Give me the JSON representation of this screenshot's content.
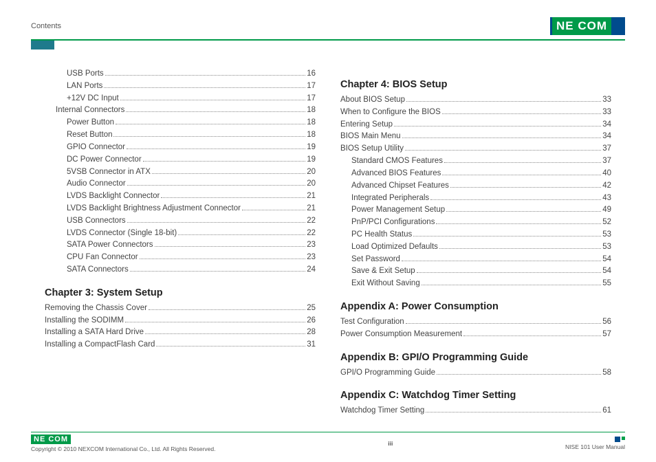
{
  "header": {
    "section_label": "Contents",
    "logo_text": "NE COM"
  },
  "left": {
    "opening_entries": [
      {
        "label": "USB Ports",
        "page": "16",
        "indent": 2
      },
      {
        "label": "LAN Ports",
        "page": "17",
        "indent": 2
      },
      {
        "label": "+12V DC Input",
        "page": "17",
        "indent": 2
      },
      {
        "label": "Internal Connectors",
        "page": "18",
        "indent": 1
      },
      {
        "label": "Power Button",
        "page": "18",
        "indent": 2
      },
      {
        "label": "Reset Button",
        "page": "18",
        "indent": 2
      },
      {
        "label": "GPIO Connector",
        "page": "19",
        "indent": 2
      },
      {
        "label": "DC Power Connector",
        "page": "19",
        "indent": 2
      },
      {
        "label": "5VSB Connector in ATX",
        "page": "20",
        "indent": 2
      },
      {
        "label": "Audio Connector",
        "page": "20",
        "indent": 2
      },
      {
        "label": "LVDS Backlight Connector",
        "page": "21",
        "indent": 2
      },
      {
        "label": "LVDS Backlight Brightness Adjustment Connector",
        "page": "21",
        "indent": 2
      },
      {
        "label": "USB Connectors",
        "page": "22",
        "indent": 2
      },
      {
        "label": "LVDS Connector (Single 18-bit)",
        "page": "22",
        "indent": 2
      },
      {
        "label": "SATA Power Connectors",
        "page": "23",
        "indent": 2
      },
      {
        "label": "CPU Fan Connector",
        "page": "23",
        "indent": 2
      },
      {
        "label": "SATA Connectors",
        "page": "24",
        "indent": 2
      }
    ],
    "chapter3": {
      "title": "Chapter 3: System Setup",
      "entries": [
        {
          "label": "Removing the Chassis Cover",
          "page": "25",
          "indent": 0
        },
        {
          "label": "Installing the SODIMM",
          "page": "26",
          "indent": 0
        },
        {
          "label": "Installing a SATA Hard Drive",
          "page": "28",
          "indent": 0
        },
        {
          "label": "Installing a CompactFlash Card",
          "page": "31",
          "indent": 0
        }
      ]
    }
  },
  "right": {
    "chapter4": {
      "title": "Chapter 4: BIOS Setup",
      "entries": [
        {
          "label": "About BIOS Setup",
          "page": "33",
          "indent": 0
        },
        {
          "label": "When to Configure the BIOS",
          "page": "33",
          "indent": 0
        },
        {
          "label": "Entering Setup",
          "page": "34",
          "indent": 0
        },
        {
          "label": "BIOS Main Menu",
          "page": "34",
          "indent": 0
        },
        {
          "label": "BIOS Setup Utility",
          "page": "37",
          "indent": 0
        },
        {
          "label": "Standard CMOS Features",
          "page": "37",
          "indent": 1
        },
        {
          "label": "Advanced BIOS Features",
          "page": "40",
          "indent": 1
        },
        {
          "label": "Advanced Chipset Features",
          "page": "42",
          "indent": 1
        },
        {
          "label": "Integrated Peripherals",
          "page": "43",
          "indent": 1
        },
        {
          "label": "Power Management Setup",
          "page": "49",
          "indent": 1
        },
        {
          "label": "PnP/PCI Configurations",
          "page": "52",
          "indent": 1
        },
        {
          "label": "PC Health Status",
          "page": "53",
          "indent": 1
        },
        {
          "label": "Load Optimized Defaults",
          "page": "53",
          "indent": 1
        },
        {
          "label": "Set Password",
          "page": "54",
          "indent": 1
        },
        {
          "label": "Save & Exit Setup",
          "page": "54",
          "indent": 1
        },
        {
          "label": "Exit Without Saving",
          "page": "55",
          "indent": 1
        }
      ]
    },
    "appendixA": {
      "title": "Appendix A: Power Consumption",
      "entries": [
        {
          "label": "Test Configuration",
          "page": "56",
          "indent": 0
        },
        {
          "label": "Power Consumption Measurement",
          "page": "57",
          "indent": 0
        }
      ]
    },
    "appendixB": {
      "title": "Appendix B: GPI/O Programming Guide",
      "entries": [
        {
          "label": "GPI/O Programming Guide",
          "page": "58",
          "indent": 0
        }
      ]
    },
    "appendixC": {
      "title": "Appendix C: Watchdog Timer Setting",
      "entries": [
        {
          "label": "Watchdog Timer Setting",
          "page": "61",
          "indent": 0
        }
      ]
    }
  },
  "footer": {
    "logo_text": "NE COM",
    "copyright": "Copyright © 2010 NEXCOM International Co., Ltd. All Rights Reserved.",
    "page_number": "iii",
    "doc_title": "NISE 101 User Manual"
  }
}
